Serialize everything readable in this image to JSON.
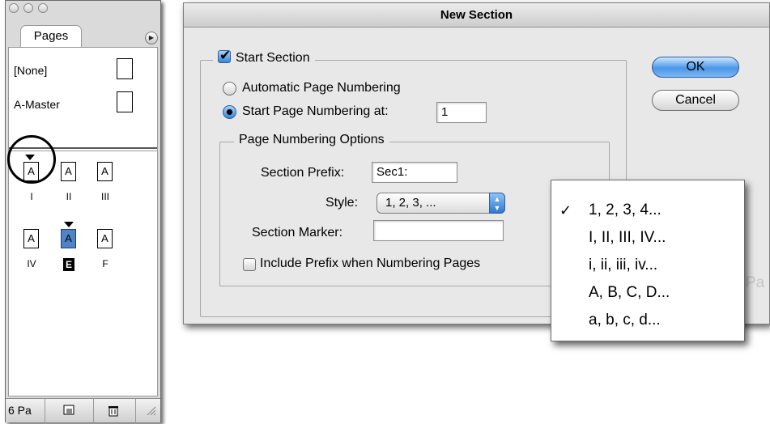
{
  "pages_panel": {
    "tab_label": "Pages",
    "masters": [
      {
        "label": "[None]"
      },
      {
        "label": "A-Master"
      }
    ],
    "pages": [
      {
        "thumb": "A",
        "label": "I"
      },
      {
        "thumb": "A",
        "label": "II"
      },
      {
        "thumb": "A",
        "label": "III"
      },
      {
        "thumb": "A",
        "label": "IV"
      },
      {
        "thumb": "A",
        "label": "E"
      },
      {
        "thumb": "A",
        "label": "F"
      }
    ],
    "footer_count": "6 Pa",
    "icons": {
      "new_page": "new-page-icon",
      "delete": "trash-icon",
      "resize": "resize-grip-icon",
      "panel_menu": "panel-menu-icon"
    }
  },
  "dialog": {
    "title": "New Section",
    "start_section": {
      "label": "Start Section",
      "checked": true
    },
    "auto_numbering": {
      "label": "Automatic Page Numbering",
      "selected": false
    },
    "start_numbering": {
      "label": "Start Page Numbering at:",
      "selected": true,
      "value": "1"
    },
    "numbering_options": {
      "title": "Page Numbering Options",
      "section_prefix_label": "Section Prefix:",
      "section_prefix_value": "Sec1:",
      "style_label": "Style:",
      "style_value": "1, 2, 3, ...",
      "section_marker_label": "Section Marker:",
      "section_marker_value": "",
      "include_prefix": {
        "label": "Include Prefix when Numbering Pages",
        "checked": false
      }
    },
    "ok_label": "OK",
    "cancel_label": "Cancel"
  },
  "style_menu": {
    "check_glyph": "✓",
    "items": [
      {
        "label": "1, 2, 3, 4...",
        "checked": true
      },
      {
        "label": "I, II, III, IV...",
        "checked": false
      },
      {
        "label": "i, ii, iii, iv...",
        "checked": false
      },
      {
        "label": "A, B, C, D...",
        "checked": false
      },
      {
        "label": "a, b, c, d...",
        "checked": false
      }
    ]
  },
  "colors": {
    "accent_blue": "#3a85d8",
    "selected_page": "#4f84c8"
  }
}
